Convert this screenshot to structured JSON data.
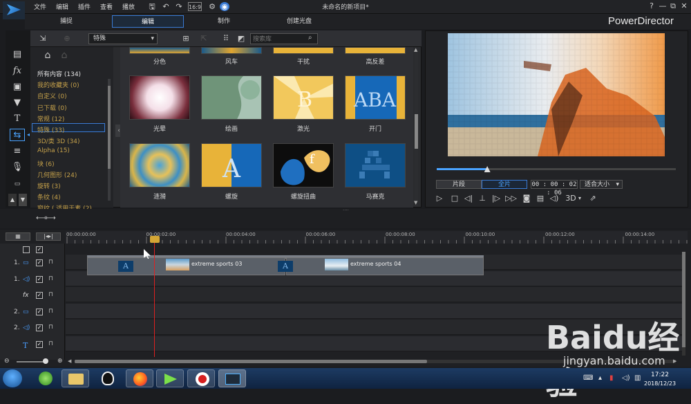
{
  "menu": [
    "文件",
    "编辑",
    "插件",
    "查看",
    "播放"
  ],
  "title": "未命名的新项目*",
  "brand": "PowerDirector",
  "window_buttons": [
    "?",
    "—",
    "⧉",
    "✕"
  ],
  "modes": [
    "捕捉",
    "编辑",
    "制作",
    "创建光盘"
  ],
  "library": {
    "filter": "特殊",
    "search_placeholder": "搜索库",
    "categories": [
      {
        "label": "所有内容 (134)",
        "white": true
      },
      {
        "label": "我的收藏夹  (0)"
      },
      {
        "label": "自定义  (0)"
      },
      {
        "label": "已下载  (0)"
      },
      {
        "label": "常规  (12)"
      },
      {
        "label": "特殊  (33)",
        "selected": true
      },
      {
        "label": "3D/类 3D  (34)"
      },
      {
        "label": "Alpha  (15)"
      },
      {
        "label": "块  (6)"
      },
      {
        "label": "几何图形  (24)"
      },
      {
        "label": "旋转  (3)"
      },
      {
        "label": "条纹  (4)"
      },
      {
        "label": "窗纹 ( 适用于素 (2)"
      }
    ],
    "top_labels": [
      "分色",
      "风车",
      "干扰",
      "高反差"
    ],
    "row1_labels": [
      "光晕",
      "绘画",
      "激光",
      "开门"
    ],
    "row2_labels": [
      "涟漪",
      "螺旋",
      "螺旋扭曲",
      "马赛克"
    ]
  },
  "preview": {
    "tab_clip": "片段",
    "tab_full": "全片",
    "timecode": "00 : 00 : 02 : 06",
    "fit": "适合大小",
    "mode_3d": "3D",
    "scrub_fraction": 0.21
  },
  "timeline": {
    "ticks": [
      "00:00:00:00",
      "00:00:02:00",
      "00:00:04:00",
      "00:00:06:00",
      "00:00:08:00",
      "00:00:10:00",
      "00:00:12:00",
      "00:00:14:00"
    ],
    "tracks": [
      {
        "num": "1.",
        "icon": "video-track-icon"
      },
      {
        "num": "1.",
        "icon": "audio-track-icon"
      },
      {
        "num": "",
        "icon": "fx-track-icon"
      },
      {
        "num": "2.",
        "icon": "video-track-icon"
      },
      {
        "num": "2.",
        "icon": "audio-track-icon"
      },
      {
        "num": "",
        "icon": "title-track-icon"
      }
    ],
    "clip1": "extreme sports 03",
    "clip2": "extreme sports 04"
  },
  "taskbar": {
    "time": "17:22",
    "date": "2018/12/23"
  },
  "watermark": {
    "brand": "Baidu经验",
    "url": "jingyan.baidu.com"
  }
}
